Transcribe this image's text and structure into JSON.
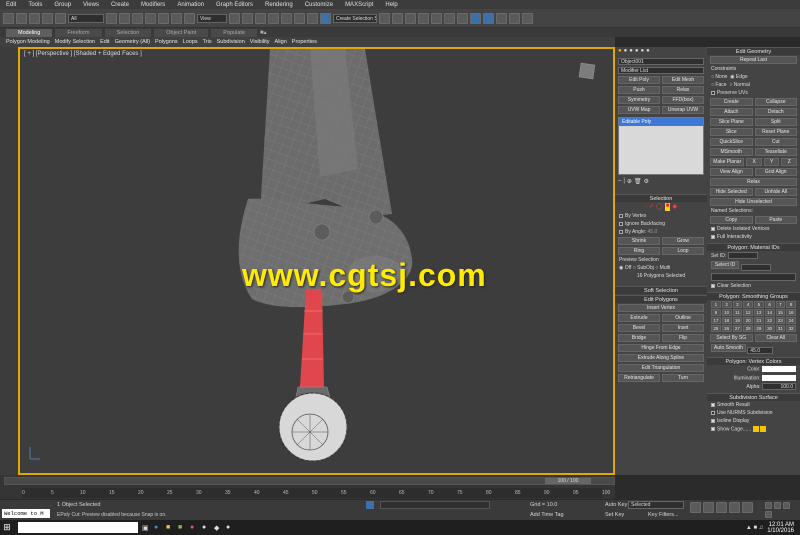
{
  "menu": [
    "Edit",
    "Tools",
    "Group",
    "Views",
    "Create",
    "Modifiers",
    "Animation",
    "Graph Editors",
    "Rendering",
    "Customize",
    "MAXScript",
    "Help"
  ],
  "toolbar": {
    "filter": "All",
    "ref_coord": "View",
    "selection_set": "Create Selection S"
  },
  "ribbon": {
    "tabs": [
      "Modeling",
      "Freeform",
      "Selection",
      "Object Paint",
      "Populate"
    ],
    "items": [
      "Polygon Modeling",
      "Modify Selection",
      "Edit",
      "Geometry (All)",
      "Polygons",
      "Loops",
      "Tris",
      "Subdivision",
      "Visibility",
      "Align",
      "Properties"
    ]
  },
  "viewport": {
    "label": "[ + ] [Perspective ] [Shaded + Edged Faces ]",
    "watermark": "www.cgtsj.com",
    "accent": "#e0a800"
  },
  "command_panel": {
    "object_name": "Object001",
    "modifier_list": "Modifier List",
    "mod_buttons": [
      [
        "Edit Poly",
        "Edit Mesh"
      ],
      [
        "Push",
        "Relax"
      ],
      [
        "Symmetry",
        "FFD(box)"
      ],
      [
        "UVW Map",
        "Unwrap UVW"
      ]
    ],
    "stack_item": "Editable Poly",
    "selection_title": "Selection",
    "by_vertex": "By Vertex",
    "ignore_backfacing": "Ignore Backfacing",
    "by_angle": "By Angle:",
    "by_angle_value": "45.0",
    "shrink": "Shrink",
    "grow": "Grow",
    "ring": "Ring",
    "loop": "Loop",
    "preview_selection": "Preview Selection",
    "preview_opts": [
      "Off",
      "SubObj",
      "Multi"
    ],
    "selected_info": "16 Polygons Selected",
    "soft_selection": "Soft Selection",
    "edit_polygons": "Edit Polygons",
    "insert_vertex": "Insert Vertex",
    "poly_ops": [
      [
        "Extrude",
        "Outline"
      ],
      [
        "Bevel",
        "Inset"
      ],
      [
        "Bridge",
        "Flip"
      ]
    ],
    "hinge": "Hinge From Edge",
    "extrude_spline": "Extrude Along Spline",
    "edit_triangulation": "Edit Triangulation",
    "retriangulate": "Retriangulate",
    "turn": "Turn"
  },
  "right_panel": {
    "edit_geometry": "Edit Geometry",
    "repeat_last": "Repeat Last",
    "constraints": "Constraints",
    "constraint_opts": [
      "None",
      "Edge",
      "Face",
      "Normal"
    ],
    "preserve_uvs": "Preserve UVs",
    "create": "Create",
    "collapse": "Collapse",
    "attach": "Attach",
    "detach": "Detach",
    "slice_plane": "Slice Plane",
    "split": "Split",
    "slice": "Slice",
    "reset_plane": "Reset Plane",
    "quickslice": "QuickSlice",
    "cut": "Cut",
    "msmooth": "MSmooth",
    "tessellate": "Tessellate",
    "make_planar": "Make Planar",
    "x": "X",
    "y": "Y",
    "z": "Z",
    "view_align": "View Align",
    "grid_align": "Grid Align",
    "relax": "Relax",
    "hide_selected": "Hide Selected",
    "unhide_all": "Unhide All",
    "hide_unselected": "Hide Unselected",
    "named_selections": "Named Selections:",
    "copy": "Copy",
    "paste": "Paste",
    "delete_isolated": "Delete Isolated Vertices",
    "full_interactivity": "Full Interactivity",
    "material_ids": "Polygon: Material IDs",
    "set_id": "Set ID:",
    "select_id": "Select ID",
    "clear_selection": "Clear Selection",
    "smoothing_groups": "Polygon: Smoothing Groups",
    "sg_numbers": [
      "1",
      "2",
      "3",
      "4",
      "5",
      "6",
      "7",
      "8",
      "9",
      "10",
      "11",
      "12",
      "13",
      "14",
      "15",
      "16",
      "17",
      "18",
      "19",
      "20",
      "21",
      "22",
      "23",
      "24",
      "25",
      "26",
      "27",
      "28",
      "29",
      "30",
      "31",
      "32"
    ],
    "select_by_sg": "Select By SG",
    "clear_all": "Clear All",
    "auto_smooth": "Auto Smooth",
    "auto_smooth_value": "45.0",
    "vertex_colors": "Polygon: Vertex Colors",
    "color": "Color:",
    "illumination": "Illumination:",
    "alpha": "Alpha:",
    "alpha_value": "100.0",
    "subdivision_surface": "Subdivision Surface",
    "smooth_result": "Smooth Result",
    "use_nurms": "Use NURMS Subdivision",
    "isoline": "Isoline Display",
    "show_cage": "Show Cage......"
  },
  "timeline": {
    "frame": "100 / 100",
    "ticks": [
      "0",
      "5",
      "10",
      "15",
      "20",
      "25",
      "30",
      "35",
      "40",
      "45",
      "50",
      "55",
      "60",
      "65",
      "70",
      "75",
      "80",
      "85",
      "90",
      "95",
      "100"
    ]
  },
  "status": {
    "listener": "Welcome to M",
    "objects_selected": "1 Object Selected",
    "prompt": "EPoly Cut: Preview disabled because Snap is on.",
    "grid": "Grid = 10.0",
    "add_time_tag": "Add Time Tag",
    "auto_key": "Auto Key",
    "auto_key_mode": "Selected",
    "set_key": "Set Key",
    "key_filters": "Key Filters..."
  },
  "taskbar": {
    "time": "12:01 AM",
    "date": "1/10/2016"
  }
}
